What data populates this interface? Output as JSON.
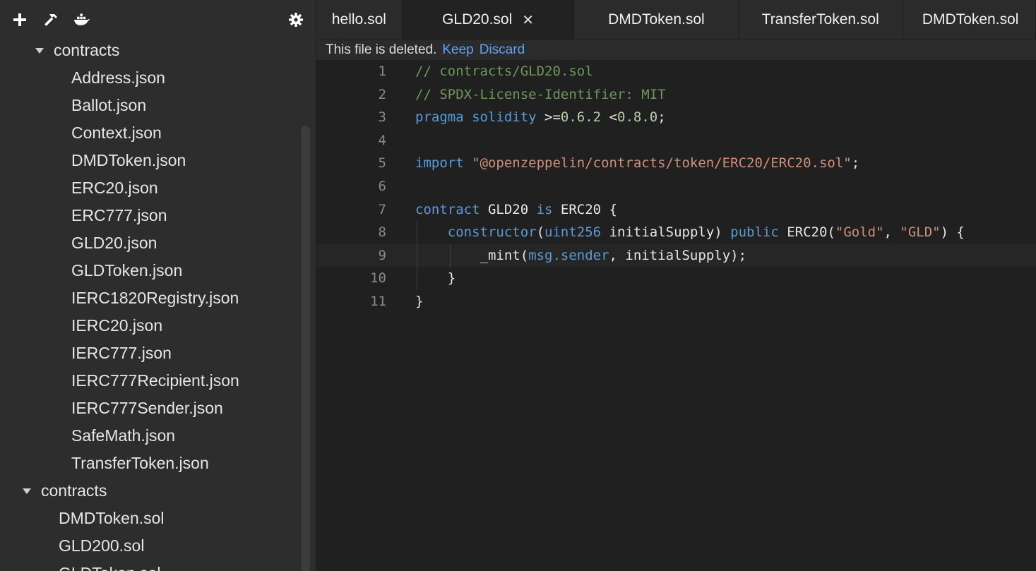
{
  "toolbar": {
    "icons": [
      "plus-icon",
      "hammer-icon",
      "docker-icon",
      "gear-icon"
    ]
  },
  "file_tree": {
    "folder1": {
      "label": "contracts"
    },
    "folder1_files": [
      "Address.json",
      "Ballot.json",
      "Context.json",
      "DMDToken.json",
      "ERC20.json",
      "ERC777.json",
      "GLD20.json",
      "GLDToken.json",
      "IERC1820Registry.json",
      "IERC20.json",
      "IERC777.json",
      "IERC777Recipient.json",
      "IERC777Sender.json",
      "SafeMath.json",
      "TransferToken.json"
    ],
    "folder2": {
      "label": "contracts"
    },
    "folder2_files": [
      "DMDToken.sol",
      "GLD200.sol",
      "GLDToken.sol"
    ]
  },
  "tabs": [
    {
      "label": "hello.sol"
    },
    {
      "label": "GLD20.sol",
      "close": "✕"
    },
    {
      "label": "DMDToken.sol"
    },
    {
      "label": "TransferToken.sol"
    },
    {
      "label": "DMDToken.sol"
    }
  ],
  "notice": {
    "text": "This file is deleted.",
    "keep": "Keep",
    "discard": "Discard"
  },
  "code": {
    "line_numbers": [
      "1",
      "2",
      "3",
      "4",
      "5",
      "6",
      "7",
      "8",
      "9",
      "10",
      "11"
    ],
    "lines": [
      [
        {
          "t": "// contracts/GLD20.sol",
          "c": "comment"
        }
      ],
      [
        {
          "t": "// SPDX-License-Identifier: MIT",
          "c": "comment"
        }
      ],
      [
        {
          "t": "pragma solidity ",
          "c": "kw"
        },
        {
          "t": ">=",
          "c": "white"
        },
        {
          "t": "0.6.2",
          "c": "num"
        },
        {
          "t": " <",
          "c": "white"
        },
        {
          "t": "0.8.0",
          "c": "num"
        },
        {
          "t": ";",
          "c": "white"
        }
      ],
      [],
      [
        {
          "t": "import ",
          "c": "kw"
        },
        {
          "t": "\"@openzeppelin/contracts/token/ERC20/ERC20.sol\"",
          "c": "str"
        },
        {
          "t": ";",
          "c": "white"
        }
      ],
      [],
      [
        {
          "t": "contract ",
          "c": "kw"
        },
        {
          "t": "GLD20 ",
          "c": "white"
        },
        {
          "t": "is ",
          "c": "kw"
        },
        {
          "t": "ERC20 {",
          "c": "white"
        }
      ],
      [
        {
          "t": "    constructor",
          "c": "kw"
        },
        {
          "t": "(",
          "c": "white"
        },
        {
          "t": "uint256",
          "c": "kw"
        },
        {
          "t": " initialSupply) ",
          "c": "white"
        },
        {
          "t": "public ",
          "c": "kw"
        },
        {
          "t": "ERC20(",
          "c": "white"
        },
        {
          "t": "\"Gold\"",
          "c": "str"
        },
        {
          "t": ", ",
          "c": "white"
        },
        {
          "t": "\"GLD\"",
          "c": "str"
        },
        {
          "t": ") {",
          "c": "white"
        }
      ],
      [
        {
          "t": "        _mint(",
          "c": "white"
        },
        {
          "t": "msg.sender",
          "c": "kw"
        },
        {
          "t": ", initialSupply);",
          "c": "white"
        }
      ],
      [
        {
          "t": "    }",
          "c": "white"
        }
      ],
      [
        {
          "t": "}",
          "c": "white"
        }
      ]
    ]
  }
}
